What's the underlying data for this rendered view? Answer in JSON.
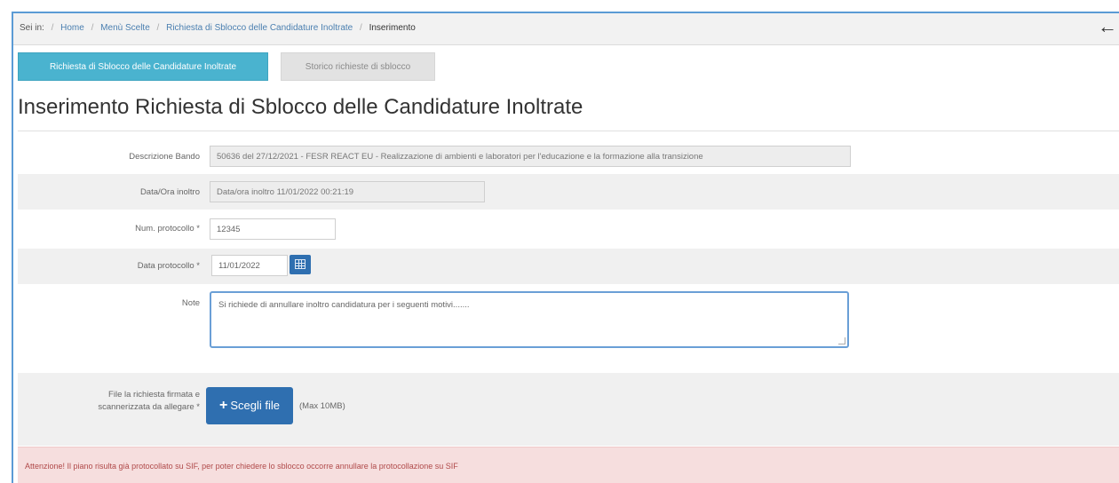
{
  "breadcrumb": {
    "prefix": "Sei in:",
    "items": [
      "Home",
      "Menù Scelte",
      "Richiesta di Sblocco delle Candidature Inoltrate"
    ],
    "current": "Inserimento"
  },
  "header": {
    "back_icon": "arrow-left-icon"
  },
  "tabs": [
    {
      "label": "Richiesta di Sblocco delle Candidature Inoltrate",
      "active": true
    },
    {
      "label": "Storico richieste di sblocco",
      "active": false
    }
  ],
  "page_title": "Inserimento Richiesta di Sblocco delle Candidature Inoltrate",
  "form": {
    "descrizione_bando": {
      "label": "Descrizione Bando",
      "value": "50636 del 27/12/2021 - FESR REACT EU - Realizzazione di ambienti e laboratori per l'educazione e la formazione alla transizione"
    },
    "data_inoltro": {
      "label": "Data/Ora inoltro",
      "value": "Data/ora inoltro 11/01/2022 00:21:19"
    },
    "num_protocollo": {
      "label": "Num. protocollo *",
      "value": "12345"
    },
    "data_protocollo": {
      "label": "Data protocollo *",
      "value": "11/01/2022",
      "calendar_icon": "calendar-icon"
    },
    "note": {
      "label": "Note",
      "value": "Si richiede di annullare inoltro candidatura per i seguenti motivi......."
    },
    "file": {
      "label_line1": "File la richiesta firmata e",
      "label_line2": "scannerizzata da allegare *",
      "button_label": "Scegli file",
      "button_icon": "plus-icon",
      "max_size": "(Max 10MB)"
    }
  },
  "alert": {
    "text": "Attenzione! Il piano risulta già protocollato su SIF, per poter chiedere lo sblocco occorre annullare la protocollazione su SIF"
  },
  "colors": {
    "tab_active": "#4ab3cf",
    "primary_button": "#2f6fb0",
    "alert_bg": "#f6dede",
    "alert_text": "#b04a4a"
  }
}
